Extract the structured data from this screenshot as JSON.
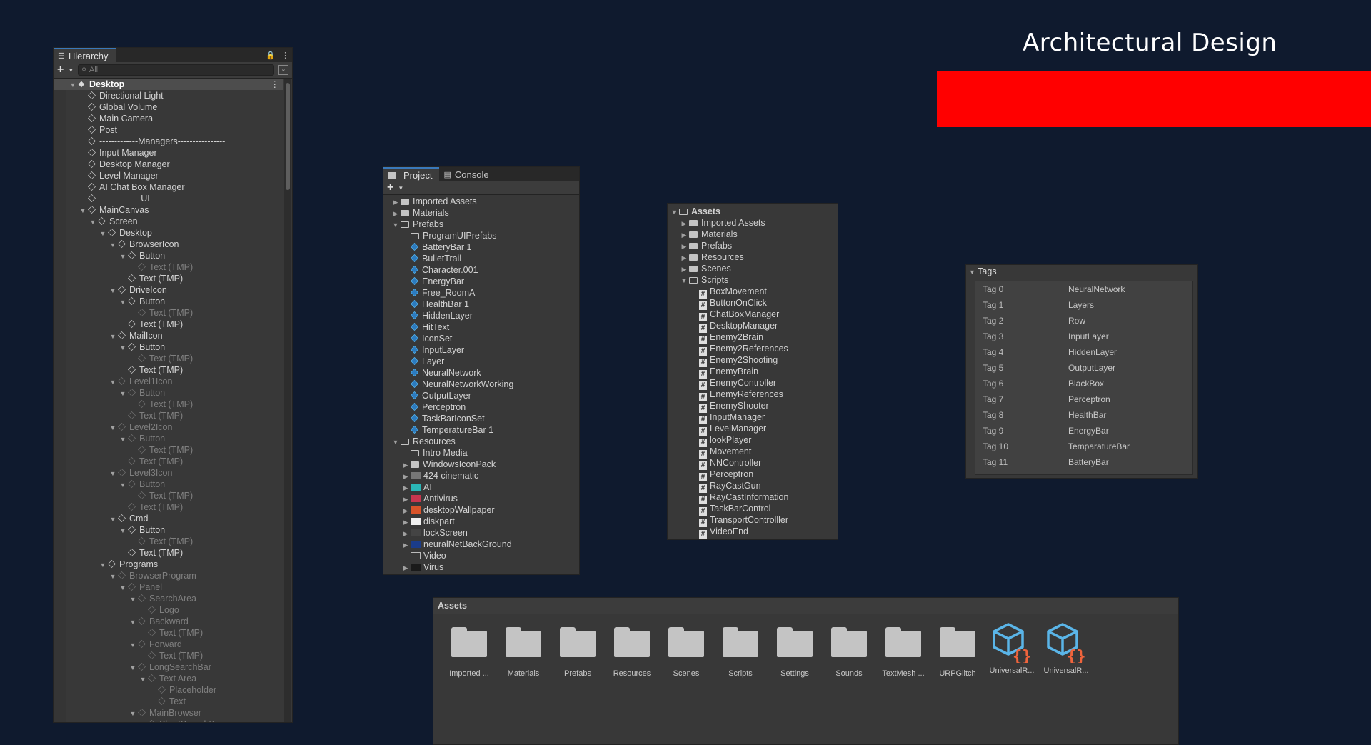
{
  "title": "Architectural Design",
  "colors": {
    "background": "#0f1a2e",
    "accent_bar": "#ff0000",
    "panel": "#383838"
  },
  "hierarchy": {
    "tab_label": "Hierarchy",
    "search_placeholder": "All",
    "rows": [
      {
        "label": "Desktop",
        "depth": 0,
        "arrow": "down",
        "selected": true,
        "faded": false
      },
      {
        "label": "Directional Light",
        "depth": 1,
        "arrow": "",
        "faded": false
      },
      {
        "label": "Global Volume",
        "depth": 1,
        "arrow": "",
        "faded": false
      },
      {
        "label": "Main Camera",
        "depth": 1,
        "arrow": "",
        "faded": false
      },
      {
        "label": "Post",
        "depth": 1,
        "arrow": "",
        "faded": false
      },
      {
        "label": "-------------Managers----------------",
        "depth": 1,
        "arrow": "",
        "faded": false
      },
      {
        "label": "Input Manager",
        "depth": 1,
        "arrow": "",
        "faded": false
      },
      {
        "label": "Desktop Manager",
        "depth": 1,
        "arrow": "",
        "faded": false
      },
      {
        "label": "Level Manager",
        "depth": 1,
        "arrow": "",
        "faded": false
      },
      {
        "label": "AI Chat Box Manager",
        "depth": 1,
        "arrow": "",
        "faded": false
      },
      {
        "label": "--------------UI--------------------",
        "depth": 1,
        "arrow": "",
        "faded": false
      },
      {
        "label": "MainCanvas",
        "depth": 1,
        "arrow": "down",
        "faded": false
      },
      {
        "label": "Screen",
        "depth": 2,
        "arrow": "down",
        "faded": false
      },
      {
        "label": "Desktop",
        "depth": 3,
        "arrow": "down",
        "faded": false
      },
      {
        "label": "BrowserIcon",
        "depth": 4,
        "arrow": "down",
        "faded": false
      },
      {
        "label": "Button",
        "depth": 5,
        "arrow": "down",
        "faded": false
      },
      {
        "label": "Text (TMP)",
        "depth": 6,
        "arrow": "",
        "faded": true
      },
      {
        "label": "Text (TMP)",
        "depth": 5,
        "arrow": "",
        "faded": false
      },
      {
        "label": "DriveIcon",
        "depth": 4,
        "arrow": "down",
        "faded": false
      },
      {
        "label": "Button",
        "depth": 5,
        "arrow": "down",
        "faded": false
      },
      {
        "label": "Text (TMP)",
        "depth": 6,
        "arrow": "",
        "faded": true
      },
      {
        "label": "Text (TMP)",
        "depth": 5,
        "arrow": "",
        "faded": false
      },
      {
        "label": "MailIcon",
        "depth": 4,
        "arrow": "down",
        "faded": false
      },
      {
        "label": "Button",
        "depth": 5,
        "arrow": "down",
        "faded": false
      },
      {
        "label": "Text (TMP)",
        "depth": 6,
        "arrow": "",
        "faded": true
      },
      {
        "label": "Text (TMP)",
        "depth": 5,
        "arrow": "",
        "faded": false
      },
      {
        "label": "Level1Icon",
        "depth": 4,
        "arrow": "down",
        "faded": true
      },
      {
        "label": "Button",
        "depth": 5,
        "arrow": "down",
        "faded": true
      },
      {
        "label": "Text (TMP)",
        "depth": 6,
        "arrow": "",
        "faded": true
      },
      {
        "label": "Text (TMP)",
        "depth": 5,
        "arrow": "",
        "faded": true
      },
      {
        "label": "Level2Icon",
        "depth": 4,
        "arrow": "down",
        "faded": true
      },
      {
        "label": "Button",
        "depth": 5,
        "arrow": "down",
        "faded": true
      },
      {
        "label": "Text (TMP)",
        "depth": 6,
        "arrow": "",
        "faded": true
      },
      {
        "label": "Text (TMP)",
        "depth": 5,
        "arrow": "",
        "faded": true
      },
      {
        "label": "Level3Icon",
        "depth": 4,
        "arrow": "down",
        "faded": true
      },
      {
        "label": "Button",
        "depth": 5,
        "arrow": "down",
        "faded": true
      },
      {
        "label": "Text (TMP)",
        "depth": 6,
        "arrow": "",
        "faded": true
      },
      {
        "label": "Text (TMP)",
        "depth": 5,
        "arrow": "",
        "faded": true
      },
      {
        "label": "Cmd",
        "depth": 4,
        "arrow": "down",
        "faded": false
      },
      {
        "label": "Button",
        "depth": 5,
        "arrow": "down",
        "faded": false
      },
      {
        "label": "Text (TMP)",
        "depth": 6,
        "arrow": "",
        "faded": true
      },
      {
        "label": "Text (TMP)",
        "depth": 5,
        "arrow": "",
        "faded": false
      },
      {
        "label": "Programs",
        "depth": 3,
        "arrow": "down",
        "faded": false
      },
      {
        "label": "BrowserProgram",
        "depth": 4,
        "arrow": "down",
        "faded": true
      },
      {
        "label": "Panel",
        "depth": 5,
        "arrow": "down",
        "faded": true
      },
      {
        "label": "SearchArea",
        "depth": 6,
        "arrow": "down",
        "faded": true
      },
      {
        "label": "Logo",
        "depth": 7,
        "arrow": "",
        "faded": true
      },
      {
        "label": "Backward",
        "depth": 6,
        "arrow": "down",
        "faded": true
      },
      {
        "label": "Text (TMP)",
        "depth": 7,
        "arrow": "",
        "faded": true
      },
      {
        "label": "Forward",
        "depth": 6,
        "arrow": "down",
        "faded": true
      },
      {
        "label": "Text (TMP)",
        "depth": 7,
        "arrow": "",
        "faded": true
      },
      {
        "label": "LongSearchBar",
        "depth": 6,
        "arrow": "down",
        "faded": true
      },
      {
        "label": "Text Area",
        "depth": 7,
        "arrow": "down",
        "faded": true
      },
      {
        "label": "Placeholder",
        "depth": 8,
        "arrow": "",
        "faded": true
      },
      {
        "label": "Text",
        "depth": 8,
        "arrow": "",
        "faded": true
      },
      {
        "label": "MainBrowser",
        "depth": 6,
        "arrow": "down",
        "faded": true
      },
      {
        "label": "ShortSearchBar",
        "depth": 7,
        "arrow": "down",
        "faded": true
      }
    ]
  },
  "project": {
    "tabs": [
      "Project",
      "Console"
    ],
    "rows": [
      {
        "label": "Imported Assets",
        "depth": 0,
        "arrow": "right",
        "icon": "folder"
      },
      {
        "label": "Materials",
        "depth": 0,
        "arrow": "right",
        "icon": "folder"
      },
      {
        "label": "Prefabs",
        "depth": 0,
        "arrow": "down",
        "icon": "folder-open"
      },
      {
        "label": "ProgramUIPrefabs",
        "depth": 1,
        "arrow": "",
        "icon": "folder-open"
      },
      {
        "label": "BatteryBar 1",
        "depth": 1,
        "arrow": "",
        "icon": "prefab"
      },
      {
        "label": "BulletTrail",
        "depth": 1,
        "arrow": "",
        "icon": "prefab"
      },
      {
        "label": "Character.001",
        "depth": 1,
        "arrow": "",
        "icon": "prefab"
      },
      {
        "label": "EnergyBar",
        "depth": 1,
        "arrow": "",
        "icon": "prefab"
      },
      {
        "label": "Free_RoomA",
        "depth": 1,
        "arrow": "",
        "icon": "prefab"
      },
      {
        "label": "HealthBar 1",
        "depth": 1,
        "arrow": "",
        "icon": "prefab"
      },
      {
        "label": "HiddenLayer",
        "depth": 1,
        "arrow": "",
        "icon": "prefab"
      },
      {
        "label": "HitText",
        "depth": 1,
        "arrow": "",
        "icon": "prefab"
      },
      {
        "label": "IconSet",
        "depth": 1,
        "arrow": "",
        "icon": "prefab"
      },
      {
        "label": "InputLayer",
        "depth": 1,
        "arrow": "",
        "icon": "prefab"
      },
      {
        "label": "Layer",
        "depth": 1,
        "arrow": "",
        "icon": "prefab"
      },
      {
        "label": "NeuralNetwork",
        "depth": 1,
        "arrow": "",
        "icon": "prefab"
      },
      {
        "label": "NeuralNetworkWorking",
        "depth": 1,
        "arrow": "",
        "icon": "prefab"
      },
      {
        "label": "OutputLayer",
        "depth": 1,
        "arrow": "",
        "icon": "prefab"
      },
      {
        "label": "Perceptron",
        "depth": 1,
        "arrow": "",
        "icon": "prefab"
      },
      {
        "label": "TaskBarIconSet",
        "depth": 1,
        "arrow": "",
        "icon": "prefab"
      },
      {
        "label": "TemperatureBar 1",
        "depth": 1,
        "arrow": "",
        "icon": "prefab"
      },
      {
        "label": "Resources",
        "depth": 0,
        "arrow": "down",
        "icon": "folder-open"
      },
      {
        "label": "Intro Media",
        "depth": 1,
        "arrow": "",
        "icon": "folder-open"
      },
      {
        "label": "WindowsIconPack",
        "depth": 1,
        "arrow": "right",
        "icon": "folder"
      },
      {
        "label": "424 cinematic-",
        "depth": 1,
        "arrow": "right",
        "icon": "thumb-gray"
      },
      {
        "label": "AI",
        "depth": 1,
        "arrow": "right",
        "icon": "thumb-teal"
      },
      {
        "label": "Antivirus",
        "depth": 1,
        "arrow": "right",
        "icon": "thumb-red"
      },
      {
        "label": "desktopWallpaper",
        "depth": 1,
        "arrow": "right",
        "icon": "thumb-orange"
      },
      {
        "label": "diskpart",
        "depth": 1,
        "arrow": "right",
        "icon": "thumb-white"
      },
      {
        "label": "lockScreen",
        "depth": 1,
        "arrow": "right",
        "icon": "thumb-dark"
      },
      {
        "label": "neuralNetBackGround",
        "depth": 1,
        "arrow": "right",
        "icon": "thumb-blue"
      },
      {
        "label": "Video",
        "depth": 1,
        "arrow": "",
        "icon": "video"
      },
      {
        "label": "Virus",
        "depth": 1,
        "arrow": "right",
        "icon": "thumb-black"
      }
    ]
  },
  "assets_tree": {
    "rows": [
      {
        "label": "Assets",
        "depth": 0,
        "arrow": "down",
        "icon": "folder-open",
        "bold": true
      },
      {
        "label": "Imported Assets",
        "depth": 1,
        "arrow": "right",
        "icon": "folder"
      },
      {
        "label": "Materials",
        "depth": 1,
        "arrow": "right",
        "icon": "folder"
      },
      {
        "label": "Prefabs",
        "depth": 1,
        "arrow": "right",
        "icon": "folder"
      },
      {
        "label": "Resources",
        "depth": 1,
        "arrow": "right",
        "icon": "folder"
      },
      {
        "label": "Scenes",
        "depth": 1,
        "arrow": "right",
        "icon": "folder"
      },
      {
        "label": "Scripts",
        "depth": 1,
        "arrow": "down",
        "icon": "folder-open"
      },
      {
        "label": "BoxMovement",
        "depth": 2,
        "arrow": "",
        "icon": "script"
      },
      {
        "label": "ButtonOnClick",
        "depth": 2,
        "arrow": "",
        "icon": "script"
      },
      {
        "label": "ChatBoxManager",
        "depth": 2,
        "arrow": "",
        "icon": "script"
      },
      {
        "label": "DesktopManager",
        "depth": 2,
        "arrow": "",
        "icon": "script"
      },
      {
        "label": "Enemy2Brain",
        "depth": 2,
        "arrow": "",
        "icon": "script"
      },
      {
        "label": "Enemy2References",
        "depth": 2,
        "arrow": "",
        "icon": "script"
      },
      {
        "label": "Enemy2Shooting",
        "depth": 2,
        "arrow": "",
        "icon": "script"
      },
      {
        "label": "EnemyBrain",
        "depth": 2,
        "arrow": "",
        "icon": "script"
      },
      {
        "label": "EnemyController",
        "depth": 2,
        "arrow": "",
        "icon": "script"
      },
      {
        "label": "EnemyReferences",
        "depth": 2,
        "arrow": "",
        "icon": "script"
      },
      {
        "label": "EnemyShooter",
        "depth": 2,
        "arrow": "",
        "icon": "script"
      },
      {
        "label": "InputManager",
        "depth": 2,
        "arrow": "",
        "icon": "script"
      },
      {
        "label": "LevelManager",
        "depth": 2,
        "arrow": "",
        "icon": "script"
      },
      {
        "label": "lookPlayer",
        "depth": 2,
        "arrow": "",
        "icon": "script"
      },
      {
        "label": "Movement",
        "depth": 2,
        "arrow": "",
        "icon": "script"
      },
      {
        "label": "NNController",
        "depth": 2,
        "arrow": "",
        "icon": "script"
      },
      {
        "label": "Perceptron",
        "depth": 2,
        "arrow": "",
        "icon": "script"
      },
      {
        "label": "RayCastGun",
        "depth": 2,
        "arrow": "",
        "icon": "script"
      },
      {
        "label": "RayCastInformation",
        "depth": 2,
        "arrow": "",
        "icon": "script"
      },
      {
        "label": "TaskBarControl",
        "depth": 2,
        "arrow": "",
        "icon": "script"
      },
      {
        "label": "TransportControlller",
        "depth": 2,
        "arrow": "",
        "icon": "script"
      },
      {
        "label": "VideoEnd",
        "depth": 2,
        "arrow": "",
        "icon": "script"
      }
    ]
  },
  "tags": {
    "title": "Tags",
    "items": [
      {
        "key": "Tag 0",
        "value": "NeuralNetwork"
      },
      {
        "key": "Tag 1",
        "value": "Layers"
      },
      {
        "key": "Tag 2",
        "value": "Row"
      },
      {
        "key": "Tag 3",
        "value": "InputLayer"
      },
      {
        "key": "Tag 4",
        "value": "HiddenLayer"
      },
      {
        "key": "Tag 5",
        "value": "OutputLayer"
      },
      {
        "key": "Tag 6",
        "value": "BlackBox"
      },
      {
        "key": "Tag 7",
        "value": "Perceptron"
      },
      {
        "key": "Tag 8",
        "value": "HealthBar"
      },
      {
        "key": "Tag 9",
        "value": "EnergyBar"
      },
      {
        "key": "Tag 10",
        "value": "TemparatureBar"
      },
      {
        "key": "Tag 11",
        "value": "BatteryBar"
      }
    ]
  },
  "assets_grid": {
    "title": "Assets",
    "items": [
      {
        "label": "Imported ...",
        "icon": "folder"
      },
      {
        "label": "Materials",
        "icon": "folder"
      },
      {
        "label": "Prefabs",
        "icon": "folder"
      },
      {
        "label": "Resources",
        "icon": "folder"
      },
      {
        "label": "Scenes",
        "icon": "folder"
      },
      {
        "label": "Scripts",
        "icon": "folder"
      },
      {
        "label": "Settings",
        "icon": "folder"
      },
      {
        "label": "Sounds",
        "icon": "folder"
      },
      {
        "label": "TextMesh ...",
        "icon": "folder"
      },
      {
        "label": "URPGlitch",
        "icon": "folder"
      },
      {
        "label": "UniversalR...",
        "icon": "package-cube"
      },
      {
        "label": "UniversalR...",
        "icon": "package-cube"
      }
    ]
  }
}
